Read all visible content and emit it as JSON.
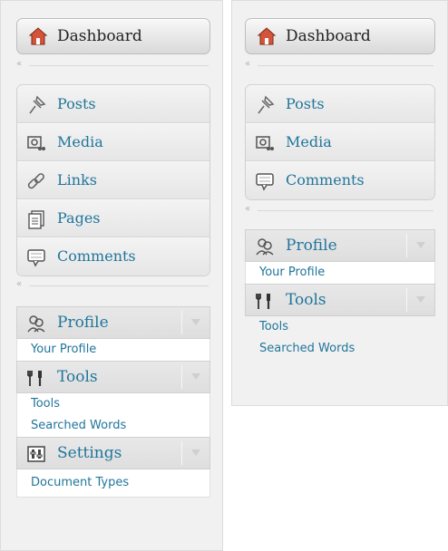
{
  "left": {
    "dashboard": "Dashboard",
    "nav": [
      {
        "label": "Posts",
        "icon": "pushpin-icon"
      },
      {
        "label": "Media",
        "icon": "media-icon"
      },
      {
        "label": "Links",
        "icon": "link-icon"
      },
      {
        "label": "Pages",
        "icon": "pages-icon"
      },
      {
        "label": "Comments",
        "icon": "comment-icon"
      }
    ],
    "profile": {
      "label": "Profile",
      "subs": [
        "Your Profile"
      ]
    },
    "tools": {
      "label": "Tools",
      "subs": [
        "Tools",
        "Searched Words"
      ]
    },
    "settings": {
      "label": "Settings",
      "subs": [
        "Document Types"
      ]
    }
  },
  "right": {
    "dashboard": "Dashboard",
    "nav": [
      {
        "label": "Posts",
        "icon": "pushpin-icon"
      },
      {
        "label": "Media",
        "icon": "media-icon"
      },
      {
        "label": "Comments",
        "icon": "comment-icon"
      }
    ],
    "profile": {
      "label": "Profile",
      "subs": [
        "Your Profile"
      ]
    },
    "tools": {
      "label": "Tools",
      "subs": [
        "Tools",
        "Searched Words"
      ]
    }
  }
}
